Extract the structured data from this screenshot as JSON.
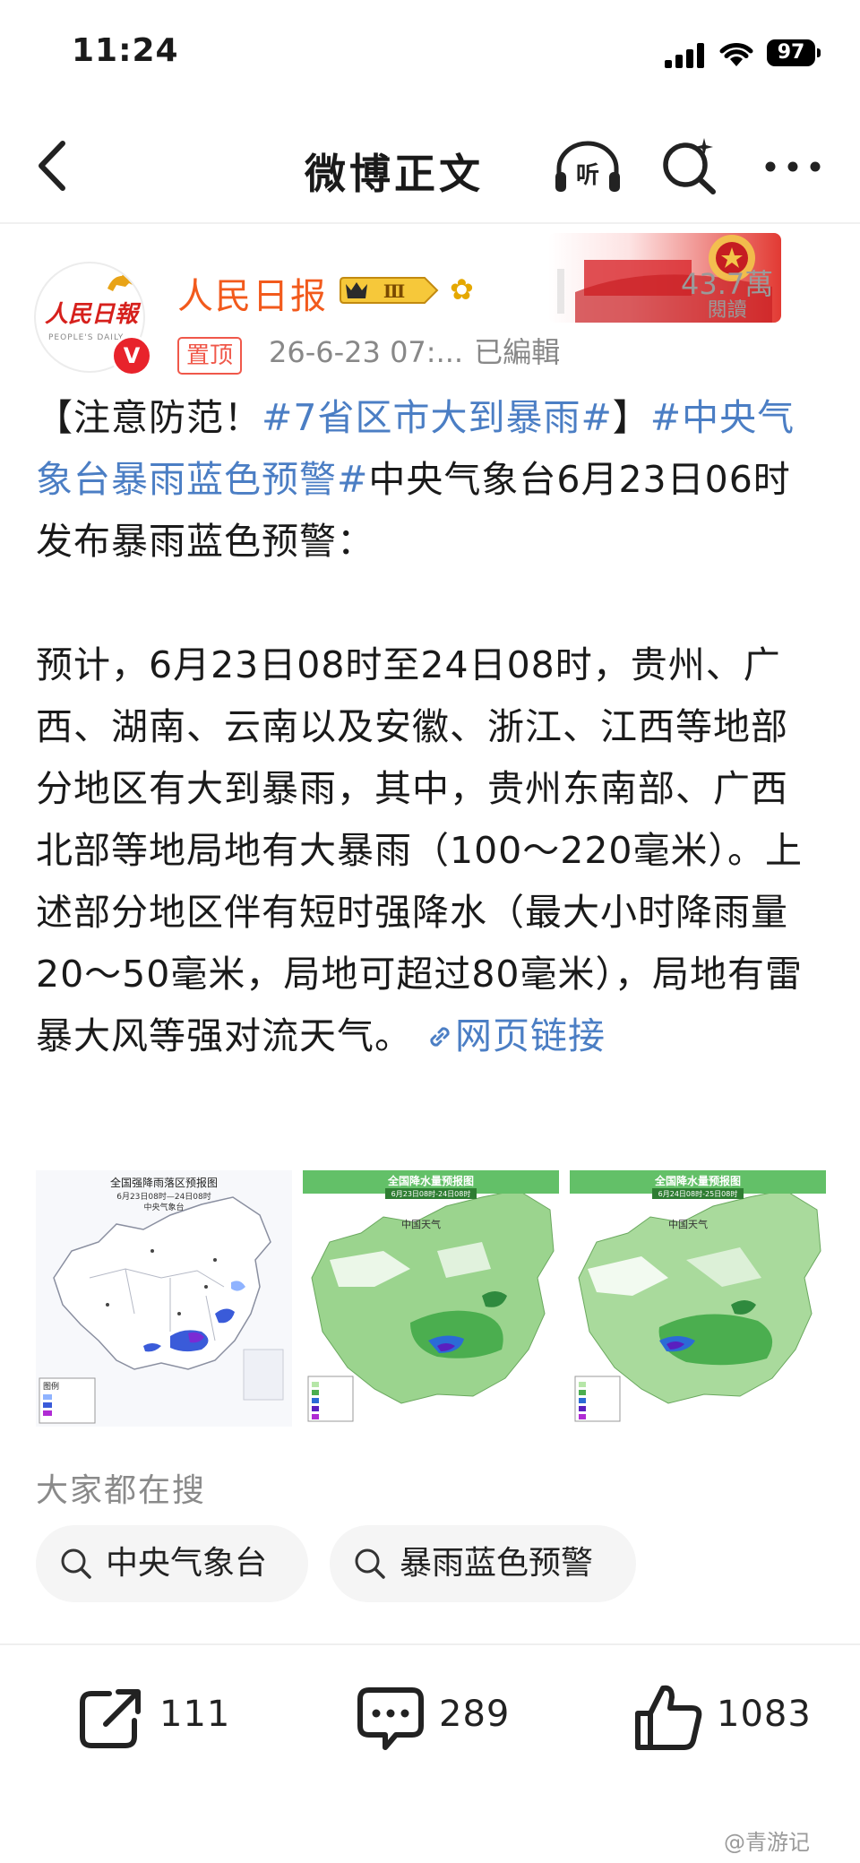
{
  "status_bar": {
    "time": "11:24",
    "battery": "97"
  },
  "nav": {
    "title": "微博正文",
    "listen_glyph": "听"
  },
  "author": {
    "name": "人民日报",
    "avatar_text": "人民日報",
    "avatar_subtext": "PEOPLE'S DAILY",
    "verified": "V",
    "level": "Ⅲ",
    "pinned_label": "置顶",
    "time": "26-6-23 07:...",
    "edited": "已編輯",
    "read_count": "43.7萬",
    "read_label": "閱讀"
  },
  "post": {
    "lines": [
      {
        "parts": [
          {
            "text": "【注意防范！",
            "tag": false
          },
          {
            "text": "#7省区市大到暴雨#",
            "tag": true
          },
          {
            "text": "】",
            "tag": false
          },
          {
            "text": "#中央气象台暴雨蓝色预警#",
            "tag": true
          },
          {
            "text": "中央气象台6月23日06时发布暴雨蓝色预警：",
            "tag": false
          }
        ]
      }
    ],
    "paragraph2": "预计，6月23日08时至24日08时，贵州、广西、湖南、云南以及安徽、浙江、江西等地部分地区有大到暴雨，其中，贵州东南部、广西北部等地局地有大暴雨（100～220毫米）。上述部分地区伴有短时强降水（最大小时降雨量20～50毫米，局地可超过80毫米），局地有雷暴大风等强对流天气。",
    "link_text": "网页链接"
  },
  "images": [
    {
      "title": "全国强降雨落区预报图",
      "subtitle": "6月23日08时—24日08时",
      "source": "中央气象台",
      "legend_title": "图例"
    },
    {
      "title": "全国降水量预报图",
      "subtitle": "6月23日08时-24日08时",
      "brand": "中国天气"
    },
    {
      "title": "全国降水量预报图",
      "subtitle": "6月24日08时-25日08时",
      "brand": "中国天气"
    }
  ],
  "hot_search": {
    "label": "大家都在搜",
    "chips": [
      "中央气象台",
      "暴雨蓝色预警"
    ]
  },
  "actions": {
    "share": "111",
    "comment": "289",
    "like": "1083"
  },
  "watermark": "@青游记",
  "colors": {
    "tag_blue": "#4b7ec4",
    "name_orange": "#f25a1c",
    "pin_red": "#f0584a",
    "verified_red": "#e8232b"
  }
}
